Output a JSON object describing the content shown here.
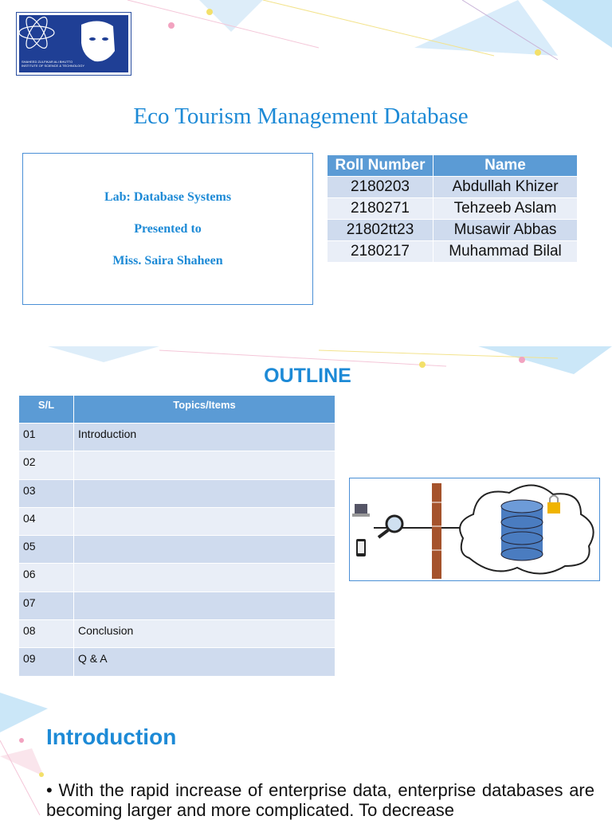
{
  "logo": {
    "line1": "SHAHEED ZULFIKAR ALI BHUTTO",
    "line2": "INSTITUTE OF SCIENCE & TECHNOLOGY"
  },
  "title": "Eco Tourism Management Database",
  "info": {
    "lab": "Lab: Database Systems",
    "presented": "Presented to",
    "teacher": "Miss. Saira Shaheen"
  },
  "members": {
    "headers": [
      "Roll Number",
      "Name"
    ],
    "rows": [
      [
        "2180203",
        "Abdullah Khizer"
      ],
      [
        "2180271",
        "Tehzeeb Aslam"
      ],
      [
        "21802tt23",
        "Musawir Abbas"
      ],
      [
        "2180217",
        "Muhammad Bilal"
      ]
    ]
  },
  "outline": {
    "title": "OUTLINE",
    "headers": [
      "S/L",
      "Topics/Items"
    ],
    "rows": [
      [
        "01",
        "Introduction"
      ],
      [
        "02",
        ""
      ],
      [
        "03",
        ""
      ],
      [
        "04",
        ""
      ],
      [
        "05",
        ""
      ],
      [
        "06",
        ""
      ],
      [
        "07",
        ""
      ],
      [
        "08",
        "Conclusion"
      ],
      [
        "09",
        "Q & A"
      ]
    ]
  },
  "introduction": {
    "heading": "Introduction",
    "text": "• With the rapid increase of enterprise data, enterprise databases are becoming larger and more complicated. To decrease"
  }
}
